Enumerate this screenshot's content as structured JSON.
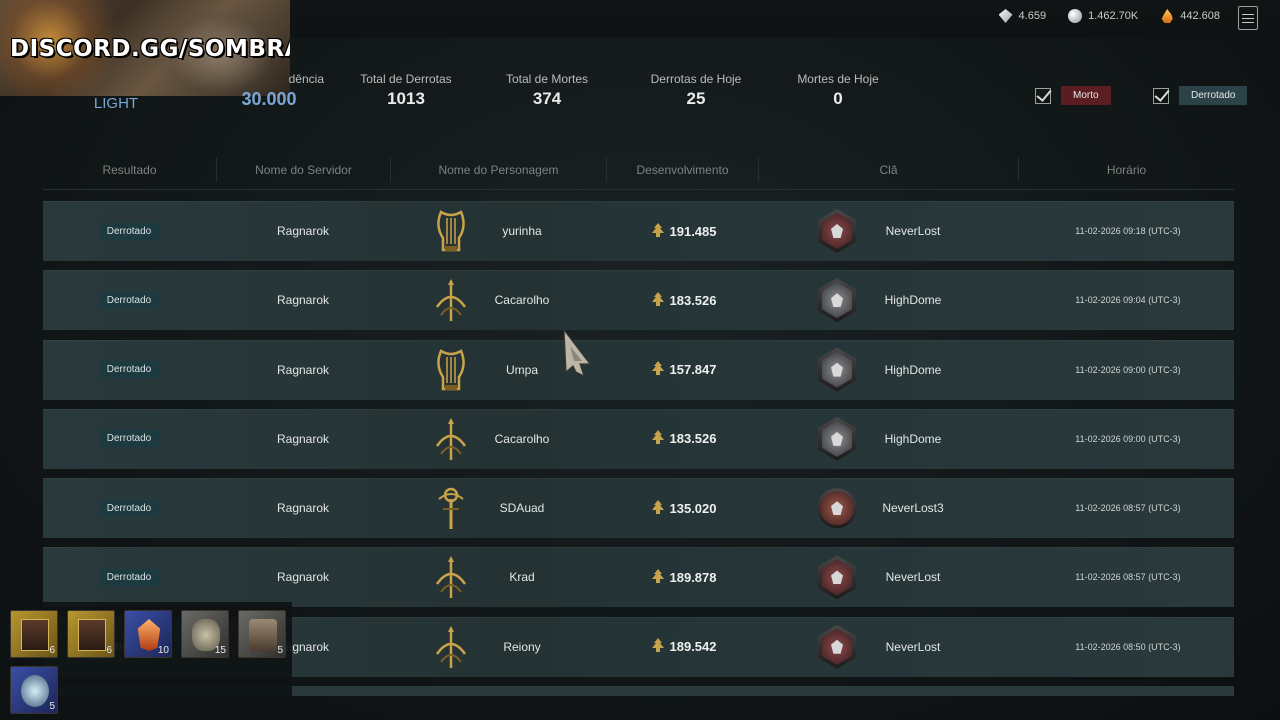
{
  "overlay": {
    "discord": "DISCORD.GG/SOMBRA"
  },
  "currencies": [
    {
      "icon": "diamond-icon",
      "value": "4.659"
    },
    {
      "icon": "silver-icon",
      "value": "1.462.70K"
    },
    {
      "icon": "flame-icon",
      "value": "442.608"
    }
  ],
  "stats": {
    "light": "LIGHT",
    "influence_label": "dência",
    "influence_value": "30.000",
    "total_defeats_label": "Total de Derrotas",
    "total_defeats_value": "1013",
    "total_deaths_label": "Total de Mortes",
    "total_deaths_value": "374",
    "today_defeats_label": "Derrotas de Hoje",
    "today_defeats_value": "25",
    "today_deaths_label": "Mortes de Hoje",
    "today_deaths_value": "0"
  },
  "filters": {
    "dead": "Morto",
    "defeated": "Derrotado"
  },
  "columns": [
    "Resultado",
    "Nome do Servidor",
    "Nome do Personagem",
    "Desenvolvimento",
    "Clã",
    "Horário"
  ],
  "rows": [
    {
      "result": "Derrotado",
      "server": "Ragnarok",
      "class": "harp",
      "name": "yurinha",
      "dev": "191.485",
      "clan_crest": "red",
      "clan": "NeverLost",
      "time": "11-02-2026 09:18 (UTC-3)"
    },
    {
      "result": "Derrotado",
      "server": "Ragnarok",
      "class": "trident",
      "name": "Cacarolho",
      "dev": "183.526",
      "clan_crest": "silver",
      "clan": "HighDome",
      "time": "11-02-2026 09:04 (UTC-3)"
    },
    {
      "result": "Derrotado",
      "server": "Ragnarok",
      "class": "harp",
      "name": "Umpa",
      "dev": "157.847",
      "clan_crest": "silver",
      "clan": "HighDome",
      "time": "11-02-2026 09:00 (UTC-3)"
    },
    {
      "result": "Derrotado",
      "server": "Ragnarok",
      "class": "trident",
      "name": "Cacarolho",
      "dev": "183.526",
      "clan_crest": "silver",
      "clan": "HighDome",
      "time": "11-02-2026 09:00 (UTC-3)"
    },
    {
      "result": "Derrotado",
      "server": "Ragnarok",
      "class": "staff",
      "name": "SDAuad",
      "dev": "135.020",
      "clan_crest": "round",
      "clan": "NeverLost3",
      "time": "11-02-2026 08:57 (UTC-3)"
    },
    {
      "result": "Derrotado",
      "server": "Ragnarok",
      "class": "trident",
      "name": "Krad",
      "dev": "189.878",
      "clan_crest": "red",
      "clan": "NeverLost",
      "time": "11-02-2026 08:57 (UTC-3)"
    },
    {
      "result": "Derrotado",
      "server": "Ragnarok",
      "class": "trident",
      "name": "Reiony",
      "dev": "189.542",
      "clan_crest": "red",
      "clan": "NeverLost",
      "time": "11-02-2026 08:50 (UTC-3)"
    }
  ],
  "inventory": [
    {
      "icon": "card-icon",
      "qty": "6",
      "style": "gold"
    },
    {
      "icon": "card-icon",
      "qty": "6",
      "style": "gold"
    },
    {
      "icon": "crystal-icon",
      "qty": "10",
      "style": "blue"
    },
    {
      "icon": "ore-icon",
      "qty": "15",
      "style": "gray"
    },
    {
      "icon": "chest-icon",
      "qty": "5",
      "style": "gray"
    },
    {
      "icon": "gem-icon",
      "qty": "5",
      "style": "blue"
    }
  ]
}
